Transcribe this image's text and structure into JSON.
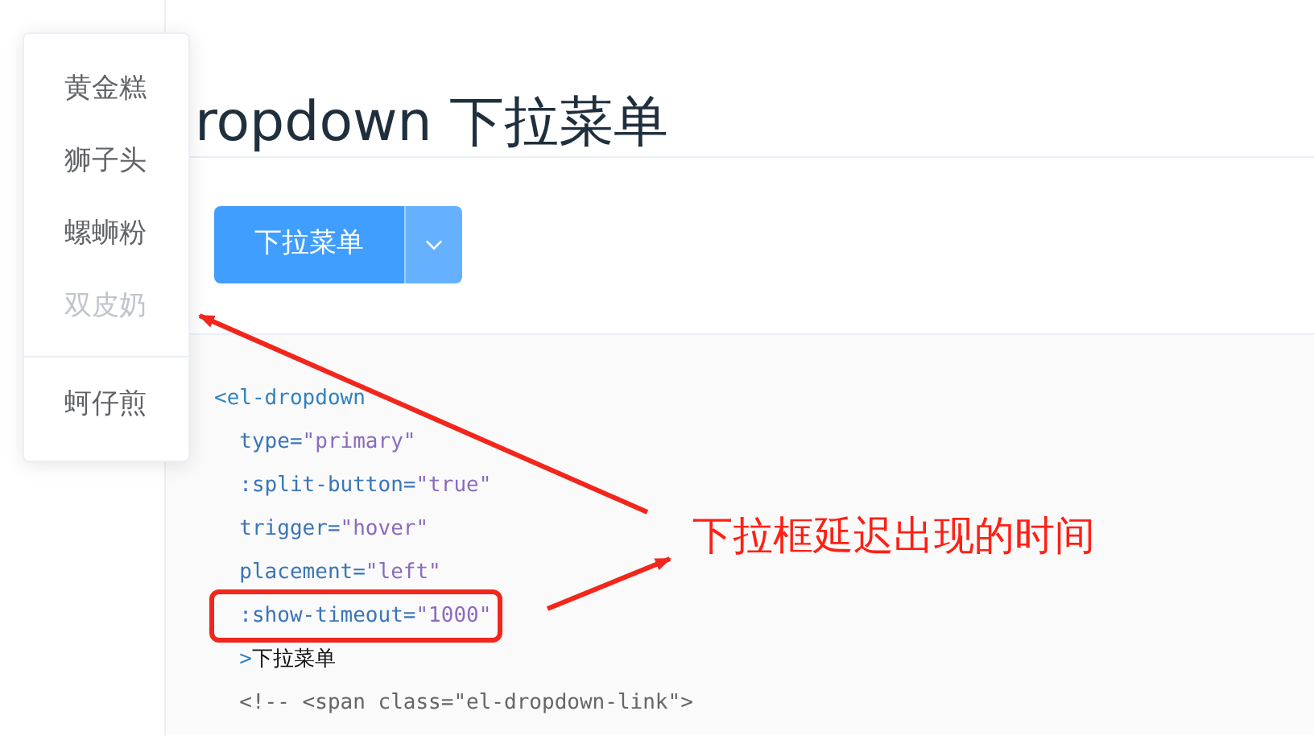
{
  "heading": "ropdown 下拉菜单",
  "split_button": {
    "label": "下拉菜单"
  },
  "dropdown_menu": [
    {
      "label": "黄金糕",
      "disabled": false,
      "divided": false
    },
    {
      "label": "狮子头",
      "disabled": false,
      "divided": false
    },
    {
      "label": "螺蛳粉",
      "disabled": false,
      "divided": false
    },
    {
      "label": "双皮奶",
      "disabled": true,
      "divided": false
    },
    {
      "label": "蚵仔煎",
      "disabled": false,
      "divided": true
    }
  ],
  "code_lines": [
    {
      "highlighted": false,
      "tokens": [
        {
          "kind": "tag",
          "text": "<el-dropdown"
        }
      ]
    },
    {
      "highlighted": false,
      "tokens": [
        {
          "kind": "attr",
          "text": "  type="
        },
        {
          "kind": "value",
          "text": "\"primary\""
        }
      ]
    },
    {
      "highlighted": false,
      "tokens": [
        {
          "kind": "attr",
          "text": "  :split-button="
        },
        {
          "kind": "value",
          "text": "\"true\""
        }
      ]
    },
    {
      "highlighted": false,
      "tokens": [
        {
          "kind": "attr",
          "text": "  trigger="
        },
        {
          "kind": "value",
          "text": "\"hover\""
        }
      ]
    },
    {
      "highlighted": false,
      "tokens": [
        {
          "kind": "attr",
          "text": "  placement="
        },
        {
          "kind": "value",
          "text": "\"left\""
        }
      ]
    },
    {
      "highlighted": true,
      "tokens": [
        {
          "kind": "attr",
          "text": "  :show-timeout="
        },
        {
          "kind": "value",
          "text": "\"1000\""
        }
      ]
    },
    {
      "highlighted": false,
      "tokens": [
        {
          "kind": "tag",
          "text": "  >"
        },
        {
          "kind": "plain",
          "text": "下拉菜单"
        }
      ]
    },
    {
      "highlighted": false,
      "tokens": [
        {
          "kind": "comment",
          "text": "  <!-- <span class=\"el-dropdown-link\">"
        }
      ]
    }
  ],
  "annotation": {
    "text": "下拉框延迟出现的时间"
  }
}
